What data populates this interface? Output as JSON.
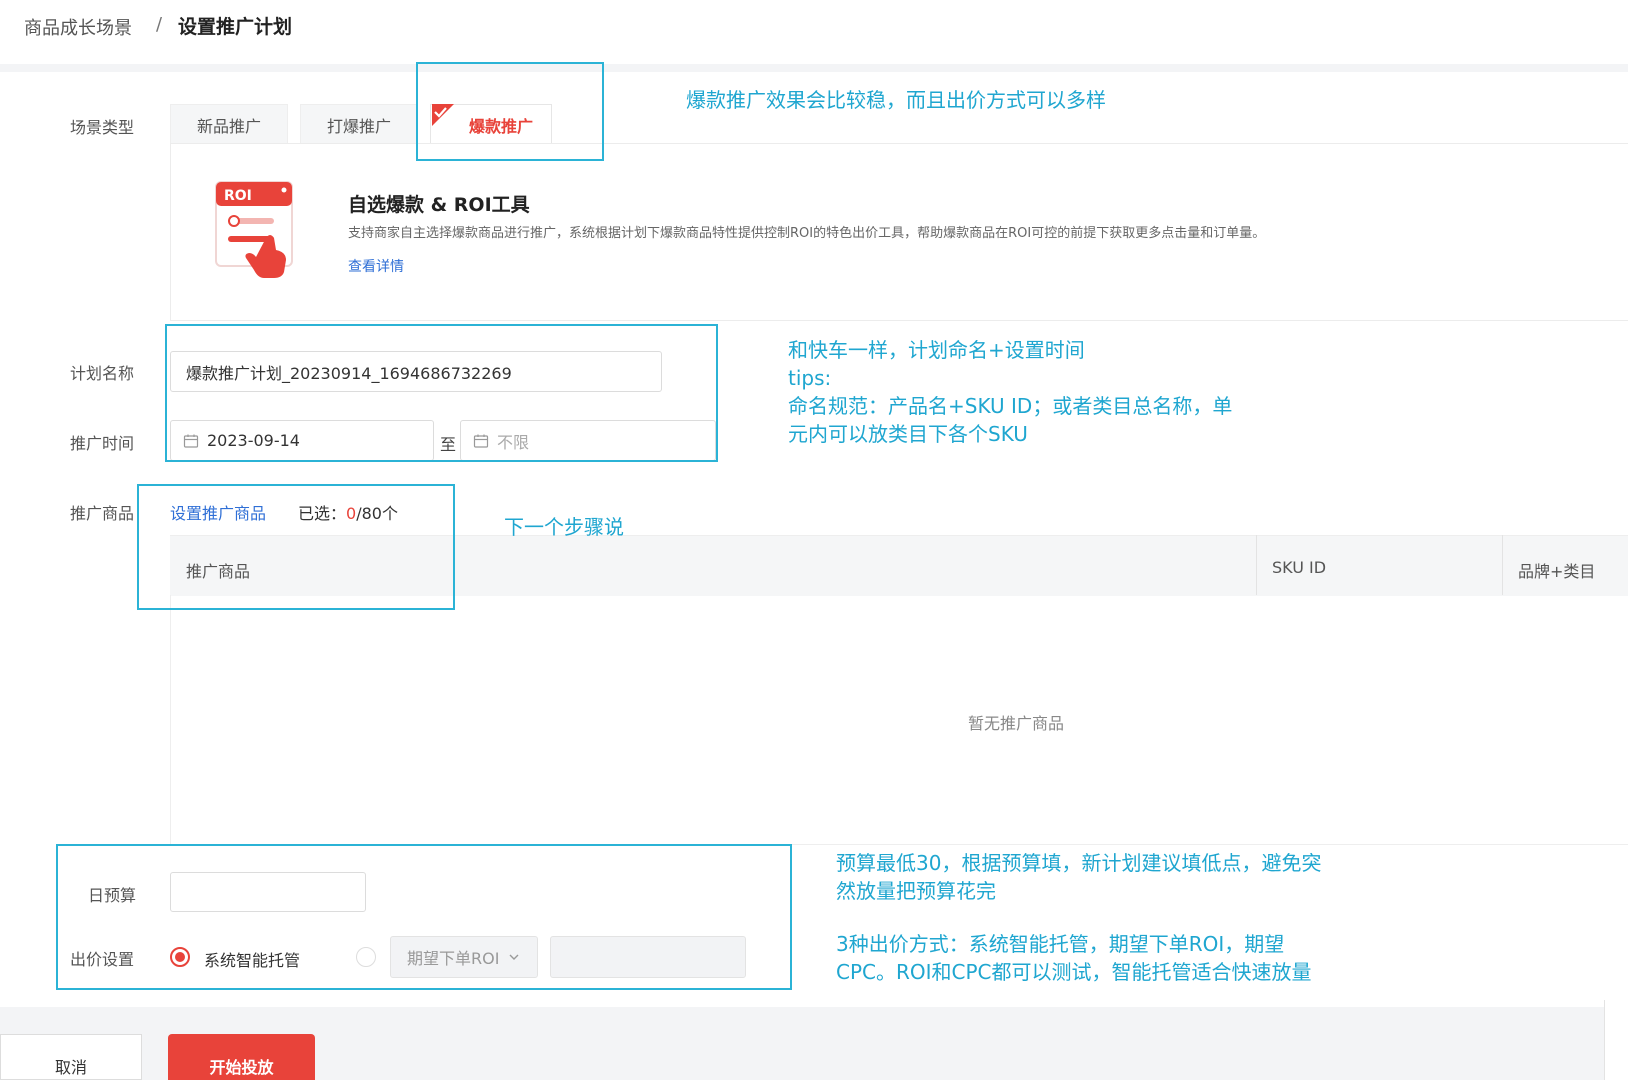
{
  "breadcrumb": {
    "parent": "商品成长场景",
    "separator": "/",
    "current": "设置推广计划"
  },
  "form": {
    "scene_label": "场景类型",
    "tabs": [
      {
        "label": "新品推广",
        "active": false
      },
      {
        "label": "打爆推广",
        "active": false
      },
      {
        "label": "爆款推广",
        "active": true
      }
    ],
    "scene_card": {
      "icon_text": "ROI",
      "title": "自选爆款 & ROI工具",
      "description": "支持商家自主选择爆款商品进行推广，系统根据计划下爆款商品特性提供控制ROI的特色出价工具，帮助爆款商品在ROI可控的前提下获取更多点击量和订单量。",
      "link": "查看详情"
    },
    "plan_name_label": "计划名称",
    "plan_name_value": "爆款推广计划_20230914_1694686732269",
    "time_label": "推广时间",
    "start_date": "2023-09-14",
    "to_text": "至",
    "end_date_placeholder": "不限",
    "product_label": "推广商品",
    "set_product_link": "设置推广商品",
    "selected_prefix": "已选：",
    "selected_count": "0",
    "selected_suffix": "/80个",
    "table_headers": [
      "推广商品",
      "SKU ID",
      "品牌+类目"
    ],
    "empty_text": "暂无推广商品",
    "budget_label": "日预算",
    "budget_value": "",
    "bid_label": "出价设置",
    "bid_option_1": "系统智能托管",
    "bid_option_2": "期望下单ROI"
  },
  "footer": {
    "cancel": "取消",
    "start": "开始投放"
  },
  "annotations": {
    "note1": "爆款推广效果会比较稳，而且出价方式可以多样",
    "note2_lines": [
      "和快车一样，计划命名+设置时间",
      "tips:",
      "命名规范：产品名+SKU ID；或者类目总名称，单",
      "元内可以放类目下各个SKU"
    ],
    "note3": "下一个步骤说",
    "note4_lines": [
      "预算最低30，根据预算填，新计划建议填低点，避免突",
      "然放量把预算花完"
    ],
    "note5_lines": [
      "3种出价方式：系统智能托管，期望下单ROI，期望",
      "CPC。ROI和CPC都可以测试，智能托管适合快速放量"
    ]
  },
  "colors": {
    "accent_red": "#e8433a",
    "link_blue": "#2f6fd6",
    "annotation_cyan": "#2bb3d6"
  }
}
